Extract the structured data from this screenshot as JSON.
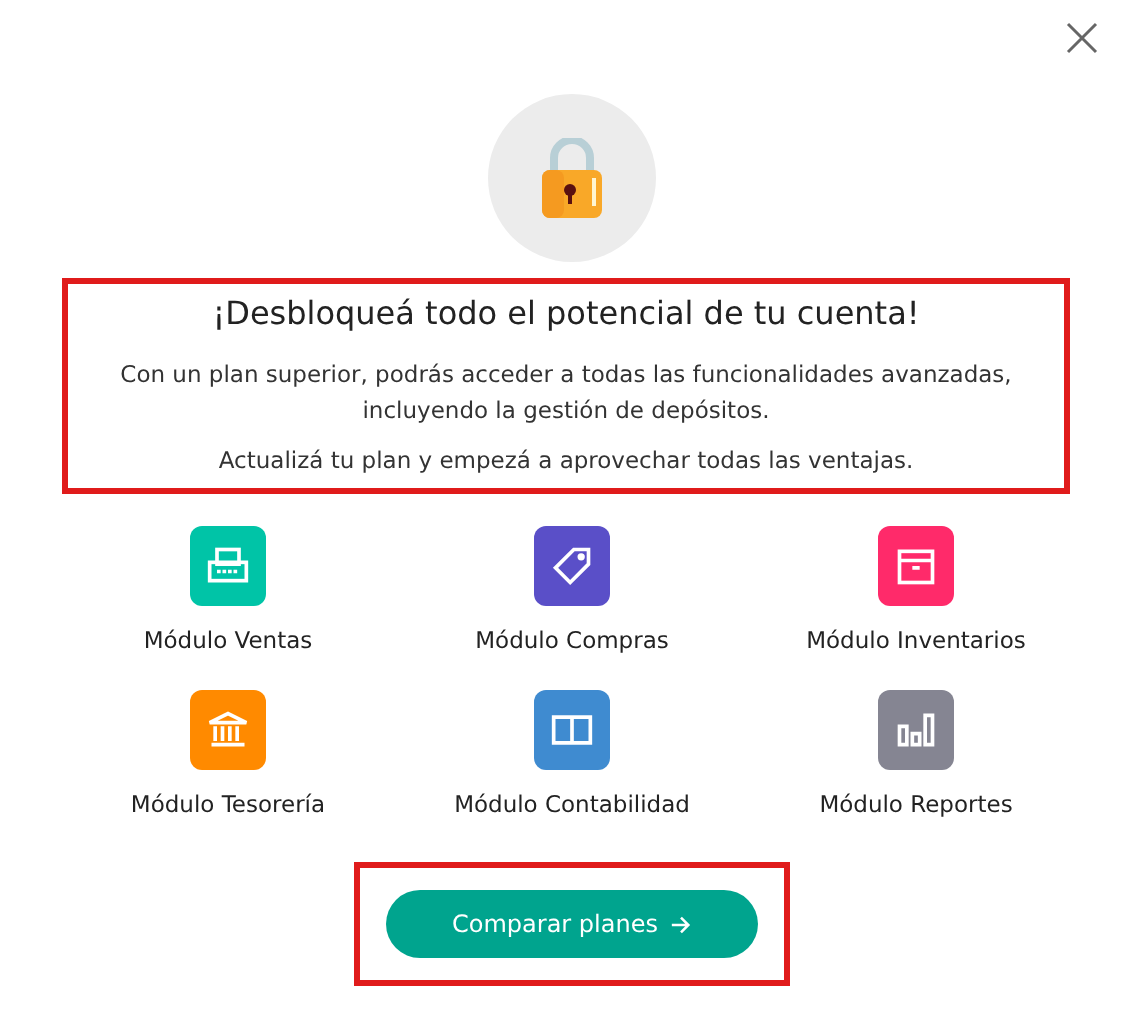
{
  "title": "¡Desbloqueá todo el potencial de tu cuenta!",
  "paragraphs": [
    "Con un plan superior, podrás acceder a todas las funcionalidades avanzadas, incluyendo la gestión de depósitos.",
    "Actualizá tu plan y empezá a aprovechar todas las ventajas."
  ],
  "modules": [
    {
      "label": "Módulo Ventas",
      "kind": "printer",
      "color": "#00c4a7"
    },
    {
      "label": "Módulo Compras",
      "kind": "tag",
      "color": "#5a4fc8"
    },
    {
      "label": "Módulo Inventarios",
      "kind": "box",
      "color": "#ff2a6a"
    },
    {
      "label": "Módulo Tesorería",
      "kind": "bank",
      "color": "#ff8a00"
    },
    {
      "label": "Módulo Contabilidad",
      "kind": "book",
      "color": "#3f8bd0"
    },
    {
      "label": "Módulo Reportes",
      "kind": "chart",
      "color": "#858592"
    }
  ],
  "button": {
    "label": "Comparar planes"
  }
}
